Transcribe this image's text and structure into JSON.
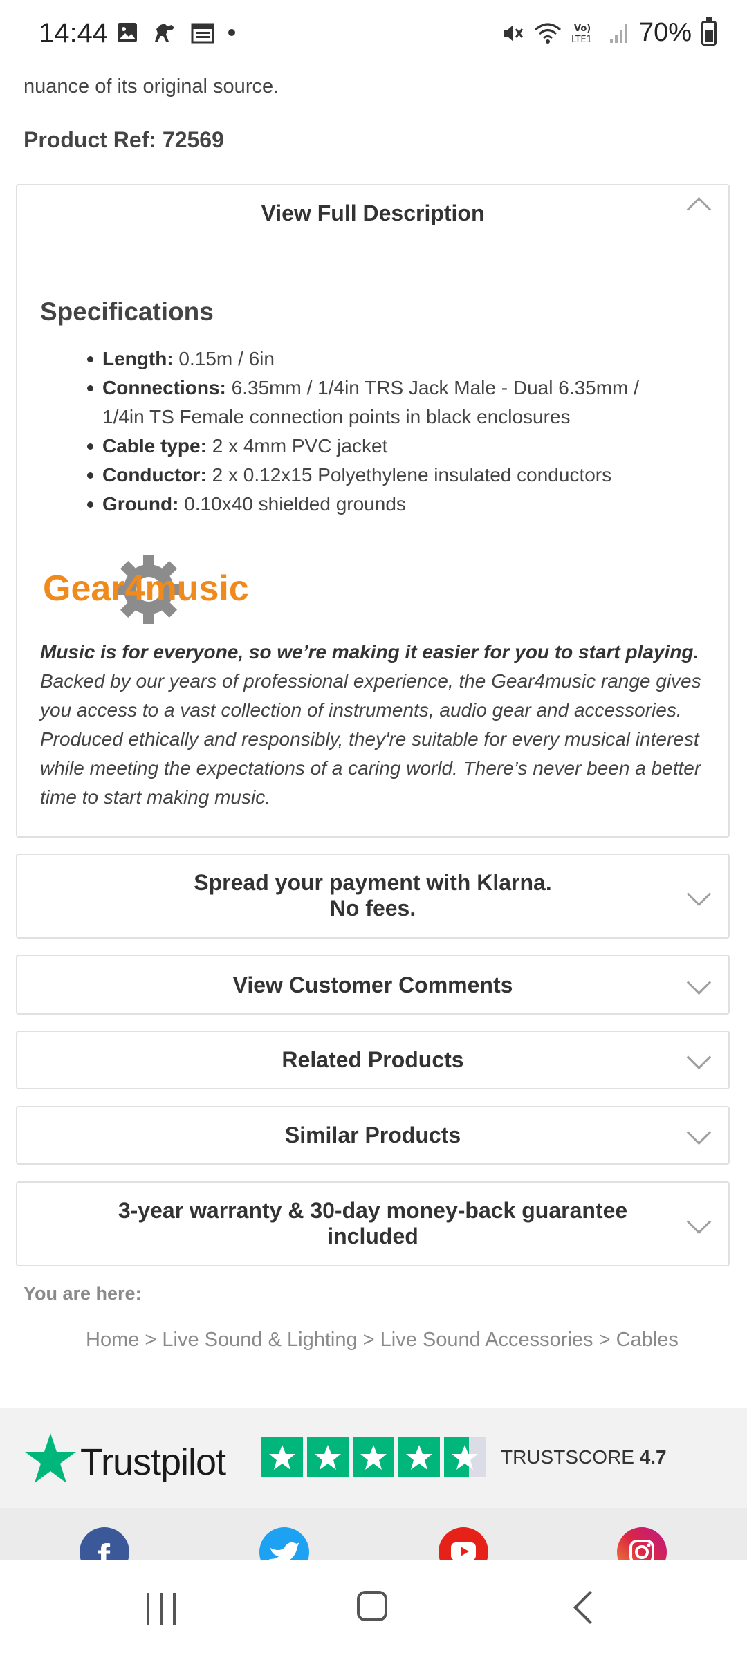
{
  "status_bar": {
    "time": "14:44",
    "battery_percent": "70%",
    "network_label": "LTE1",
    "icons": [
      "gallery-icon",
      "horse-icon",
      "calendar-icon",
      "dot-icon",
      "mute-icon",
      "wifi-icon",
      "volte-icon",
      "signal-icon",
      "battery-icon"
    ]
  },
  "top_text": "frequency response with full dynamic range that will replicate every last nuance of its original source.",
  "product_ref": "Product Ref: 72569",
  "description_panel": {
    "title": "View Full Description",
    "specs_heading": "Specifications",
    "specs": [
      {
        "key": "Length:",
        "value": " 0.15m / 6in"
      },
      {
        "key": "Connections:",
        "value": " 6.35mm / 1/4in TRS Jack Male - Dual 6.35mm / 1/4in TS Female connection points in black enclosures"
      },
      {
        "key": "Cable type:",
        "value": " 2 x 4mm PVC jacket"
      },
      {
        "key": "Conductor:",
        "value": " 2 x 0.12x15 Polyethylene insulated conductors"
      },
      {
        "key": "Ground:",
        "value": " 0.10x40 shielded grounds"
      }
    ],
    "brand_logo_text": "Gear4music",
    "brand_lead": "Music is for everyone, so we’re making it easier for you to start playing.",
    "brand_body": " Backed by our years of professional experience, the Gear4music range gives you access to a vast collection of instruments, audio gear and accessories. Produced ethically and responsibly, they're suitable for every musical interest while meeting the expectations of a caring world. There’s never been a better time to start making music."
  },
  "panels": {
    "klarna_line1": "Spread your payment with Klarna.",
    "klarna_line2": "No fees.",
    "comments": "View Customer Comments",
    "related": "Related Products",
    "similar": "Similar Products",
    "warranty_line1": "3-year warranty & 30-day money-back guarantee",
    "warranty_line2": "included"
  },
  "breadcrumb": {
    "label": "You are here:",
    "items": [
      "Home",
      "Live Sound & Lighting",
      "Live Sound Accessories",
      "Cables"
    ],
    "separator": " > "
  },
  "trustpilot": {
    "name": "Trustpilot",
    "score_label": "TRUSTSCORE",
    "score": "4.7",
    "stars_filled": 4.7,
    "stars_total": 5
  },
  "social_icons": [
    "facebook-icon",
    "twitter-icon",
    "youtube-icon",
    "instagram-icon"
  ],
  "colors": {
    "trustpilot_green": "#00b67a",
    "brand_orange": "#f08a1c",
    "facebook": "#3b5998",
    "twitter": "#1da1f2",
    "youtube": "#e62117"
  }
}
